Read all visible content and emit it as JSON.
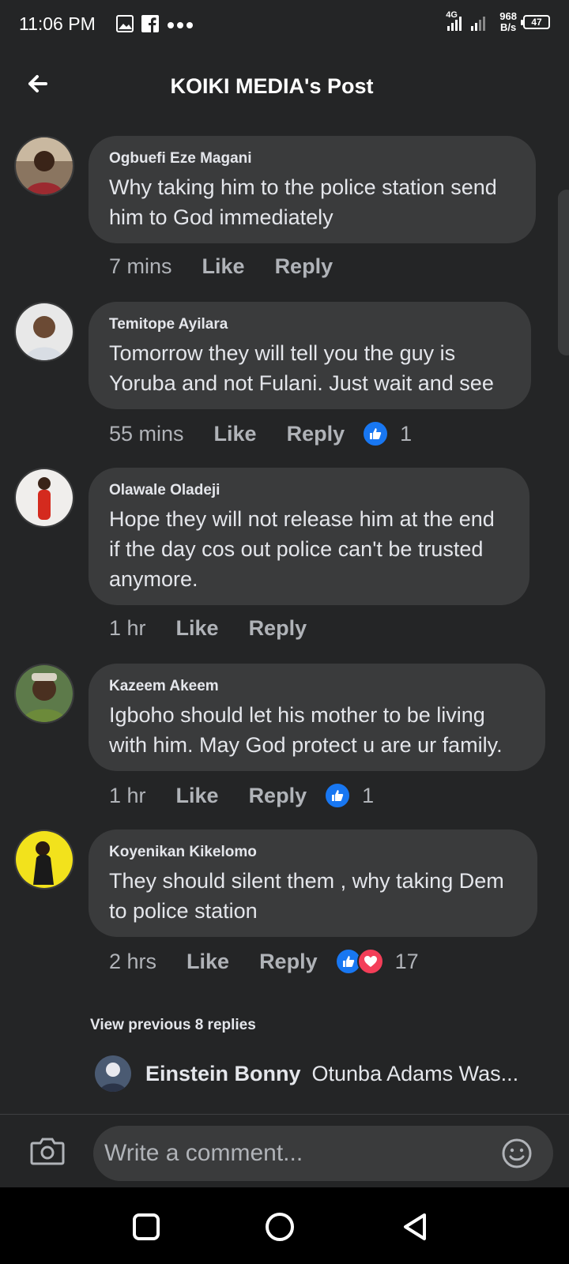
{
  "status_bar": {
    "time": "11:06 PM",
    "network": "4G",
    "speed_value": "968",
    "speed_unit": "B/s",
    "battery": "47"
  },
  "header": {
    "title": "KOIKI MEDIA's Post"
  },
  "comments": [
    {
      "author": "Ogbuefi Eze Magani",
      "text": "Why taking him to the police station send him to God immediately",
      "time": "7 mins",
      "like_label": "Like",
      "reply_label": "Reply",
      "reaction_count": ""
    },
    {
      "author": "Temitope Ayilara",
      "text": "Tomorrow they will tell you the guy is Yoruba and not Fulani. Just wait and see",
      "time": "55 mins",
      "like_label": "Like",
      "reply_label": "Reply",
      "reaction_count": "1"
    },
    {
      "author": "Olawale Oladeji",
      "text": "Hope they will not release him at the end if the day cos out police can't be trusted anymore.",
      "time": "1 hr",
      "like_label": "Like",
      "reply_label": "Reply",
      "reaction_count": ""
    },
    {
      "author": "Kazeem Akeem",
      "text": "Igboho should let his mother to be living with him. May God protect u are ur family.",
      "time": "1 hr",
      "like_label": "Like",
      "reply_label": "Reply",
      "reaction_count": "1"
    },
    {
      "author": "Koyenikan Kikelomo",
      "text": "They should silent them , why taking Dem to police station",
      "time": "2 hrs",
      "like_label": "Like",
      "reply_label": "Reply",
      "reaction_count": "17"
    }
  ],
  "view_previous": "View previous 8 replies",
  "last_reply": {
    "author": "Einstein Bonny",
    "preview": "Otunba Adams Was..."
  },
  "composer": {
    "placeholder": "Write a comment..."
  },
  "colors": {
    "background": "#242526",
    "bubble": "#3a3b3c",
    "like_blue": "#1877f2",
    "love_red": "#f33e58"
  }
}
